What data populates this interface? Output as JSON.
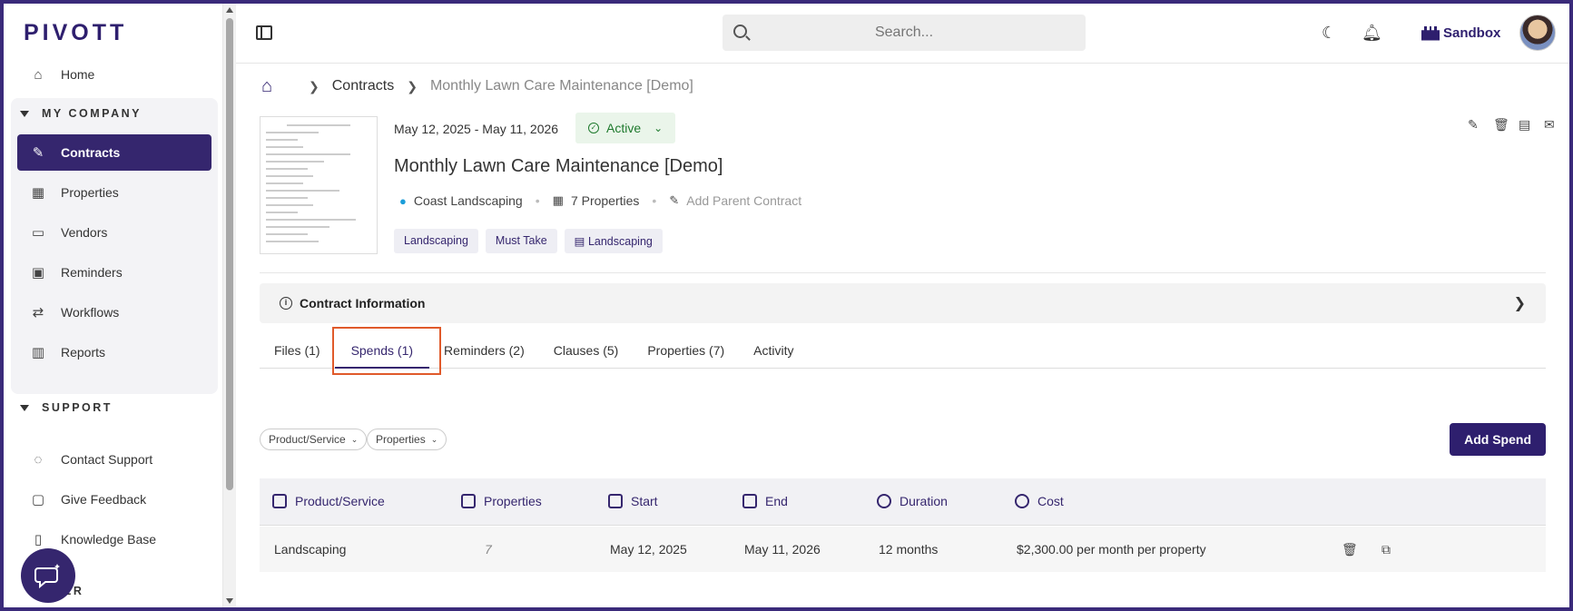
{
  "app": {
    "logo": "PIVOTT"
  },
  "sidebar": {
    "home": "Home",
    "section_company": "MY COMPANY",
    "company_items": [
      {
        "label": "Contracts",
        "icon": "contract-icon"
      },
      {
        "label": "Properties",
        "icon": "building-icon"
      },
      {
        "label": "Vendors",
        "icon": "store-icon"
      },
      {
        "label": "Reminders",
        "icon": "calendar-clock-icon"
      },
      {
        "label": "Workflows",
        "icon": "workflow-icon"
      },
      {
        "label": "Reports",
        "icon": "chart-icon"
      }
    ],
    "section_support": "SUPPORT",
    "support_items": [
      {
        "label": "Contact Support",
        "icon": "chat-icon"
      },
      {
        "label": "Give Feedback",
        "icon": "feedback-icon"
      },
      {
        "label": "Knowledge Base",
        "icon": "document-icon"
      }
    ],
    "section_partial": "ER"
  },
  "topbar": {
    "search_placeholder": "Search...",
    "workspace": "Sandbox"
  },
  "breadcrumb": {
    "items": [
      "Contracts",
      "Monthly Lawn Care Maintenance [Demo]"
    ]
  },
  "contract": {
    "date_range": "May 12, 2025 - May 11, 2026",
    "status": "Active",
    "title": "Monthly Lawn Care Maintenance [Demo]",
    "vendor": "Coast Landscaping",
    "properties": "7 Properties",
    "add_parent": "Add Parent Contract",
    "tags": [
      "Landscaping",
      "Must Take",
      "Landscaping"
    ]
  },
  "info_section": {
    "label": "Contract Information"
  },
  "tabs": [
    "Files (1)",
    "Spends (1)",
    "Reminders (2)",
    "Clauses (5)",
    "Properties (7)",
    "Activity"
  ],
  "filters": [
    "Product/Service",
    "Properties"
  ],
  "add_spend_label": "Add Spend",
  "table": {
    "columns": [
      "Product/Service",
      "Properties",
      "Start",
      "End",
      "Duration",
      "Cost"
    ],
    "rows": [
      {
        "product": "Landscaping",
        "properties": "7",
        "start": "May 12, 2025",
        "end": "May 11, 2026",
        "duration": "12 months",
        "cost": "$2,300.00 per month per property"
      }
    ]
  }
}
